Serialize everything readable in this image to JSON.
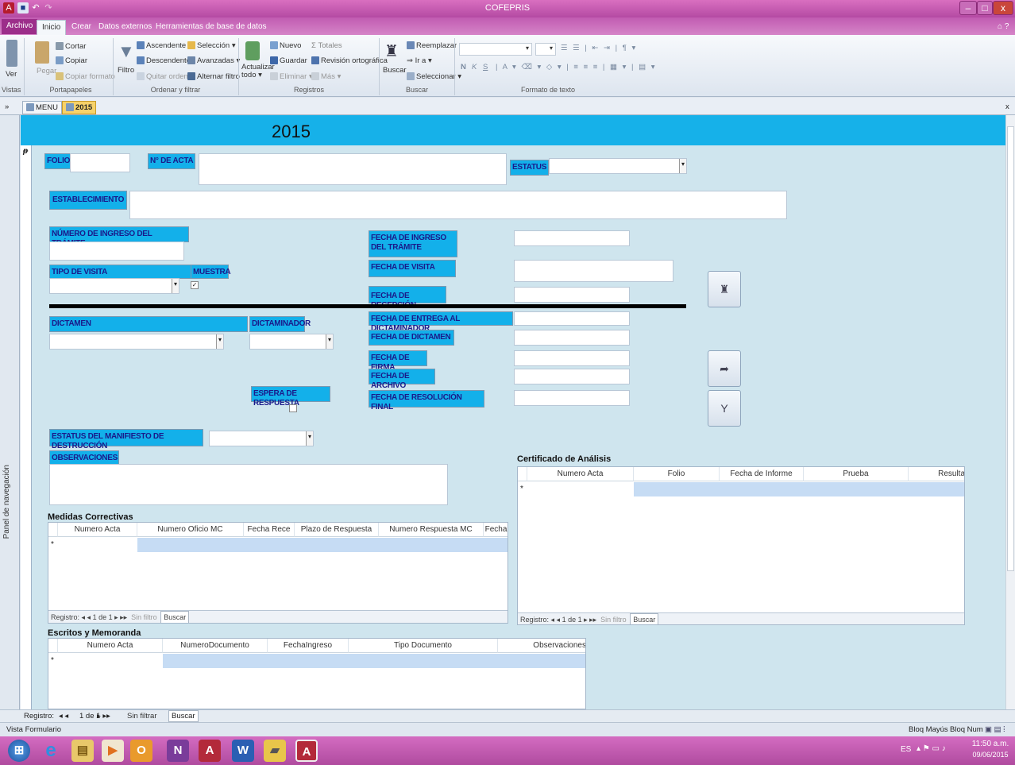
{
  "window": {
    "title": "COFEPRIS",
    "minimize": "–",
    "maximize": "□",
    "close": "x"
  },
  "quick_access": {
    "app_icon": "A",
    "save_icon": "■",
    "undo_icon": "↶",
    "redo_icon": "↷"
  },
  "ribbon_tabs": [
    "Archivo",
    "Inicio",
    "Crear",
    "Datos externos",
    "Herramientas de base de datos"
  ],
  "ribbon": {
    "vistas": {
      "ver": "Ver",
      "group": "Vistas"
    },
    "portapapeles": {
      "pegar": "Pegar",
      "cortar": "Cortar",
      "copiar": "Copiar",
      "copiar_formato": "Copiar formato",
      "group": "Portapapeles"
    },
    "ordenar": {
      "filtro": "Filtro",
      "ascendente": "Ascendente",
      "descendente": "Descendente",
      "quitar_orden": "Quitar orden",
      "seleccion": "Selección",
      "avanzadas": "Avanzadas",
      "alternar_filtro": "Alternar filtro",
      "group": "Ordenar y filtrar"
    },
    "registros": {
      "actualizar": "Actualizar",
      "todo": "todo",
      "nuevo": "Nuevo",
      "guardar": "Guardar",
      "eliminar": "Eliminar",
      "totales": "Totales",
      "revision": "Revisión ortográfica",
      "mas": "Más",
      "group": "Registros"
    },
    "buscar": {
      "buscar": "Buscar",
      "reemplazar": "Reemplazar",
      "ir_a": "Ir a",
      "seleccionar": "Seleccionar",
      "group": "Buscar"
    },
    "formato": {
      "bold": "N",
      "italic": "K",
      "underline": "S",
      "group": "Formato de texto"
    }
  },
  "doc_tabs": [
    {
      "label": "MENU"
    },
    {
      "label": "2015"
    }
  ],
  "nav_pane": {
    "label": "Panel de navegación",
    "toggle": "»"
  },
  "form": {
    "title": "2015",
    "labels": {
      "folio": "FOLIO",
      "n_acta": "N° DE ACTA",
      "estatus": "ESTATUS",
      "establecimiento": "ESTABLECIMIENTO",
      "numero_ingreso": "NÚMERO DE INGRESO DEL TRÁMITE",
      "fecha_ingreso": "FECHA DE INGRESO DEL TRÁMITE",
      "tipo_visita": "TIPO DE VISITA",
      "muestra": "MUESTRA",
      "fecha_visita": "FECHA DE VISITA",
      "fecha_recepcion": "FECHA DE RECEPCIÓN",
      "dictamen": "DICTAMEN",
      "dictaminador": "DICTAMINADOR",
      "fecha_entrega": "FECHA DE ENTREGA AL DICTAMINADOR",
      "fecha_dictamen": "FECHA DE DICTAMEN",
      "fecha_firma": "FECHA DE FIRMA",
      "fecha_archivo": "FECHA DE ARCHIVO",
      "espera_respuesta": "ESPERA DE RESPUESTA",
      "fecha_resolucion": "FECHA DE RESOLUCIÓN FINAL",
      "estatus_manifiesto": "ESTATUS DEL MANIFIESTO DE DESTRUCCIÓN",
      "observaciones": "OBSERVACIONES"
    },
    "muestra_checked": "✓",
    "buttons": {
      "search_icon": "binoculars",
      "export_icon": "export",
      "filter_icon": "filter"
    }
  },
  "subforms": {
    "medidas": {
      "title": "Medidas Correctivas",
      "columns": [
        "Numero Acta",
        "Numero Oficio MC",
        "Fecha Rece",
        "Plazo de Respuesta",
        "Numero Respuesta MC",
        "Fecha"
      ],
      "nav": {
        "registro": "Registro:",
        "pos": "1 de 1",
        "filtro": "Sin filtro",
        "buscar": "Buscar"
      }
    },
    "certificado": {
      "title": "Certificado de Análisis",
      "columns": [
        "Numero Acta",
        "Folio",
        "Fecha de Informe",
        "Prueba",
        "Resulta"
      ],
      "nav": {
        "registro": "Registro:",
        "pos": "1 de 1",
        "filtro": "Sin filtro",
        "buscar": "Buscar"
      }
    },
    "escritos": {
      "title": "Escritos y Memoranda",
      "columns": [
        "Numero Acta",
        "NumeroDocumento",
        "FechaIngreso",
        "Tipo Documento",
        "Observaciones"
      ]
    }
  },
  "record_nav": {
    "registro": "Registro:",
    "pos": "1 de 1",
    "filtro": "Sin filtrar",
    "buscar": "Buscar"
  },
  "status_bar": {
    "left": "Vista Formulario",
    "caps": "Bloq Mayús",
    "num": "Bloq Num"
  },
  "taskbar": {
    "lang": "ES",
    "time": "11:50 a.m.",
    "date": "09/06/2015",
    "apps": [
      "start",
      "ie",
      "explorer",
      "media",
      "outlook",
      "onenote",
      "access",
      "word",
      "folder",
      "access2"
    ]
  },
  "colors": {
    "title_bar": "#c553b2",
    "form_header": "#16b1e9",
    "label_bg": "#13b0ea",
    "form_bg": "#cfe5ee"
  }
}
